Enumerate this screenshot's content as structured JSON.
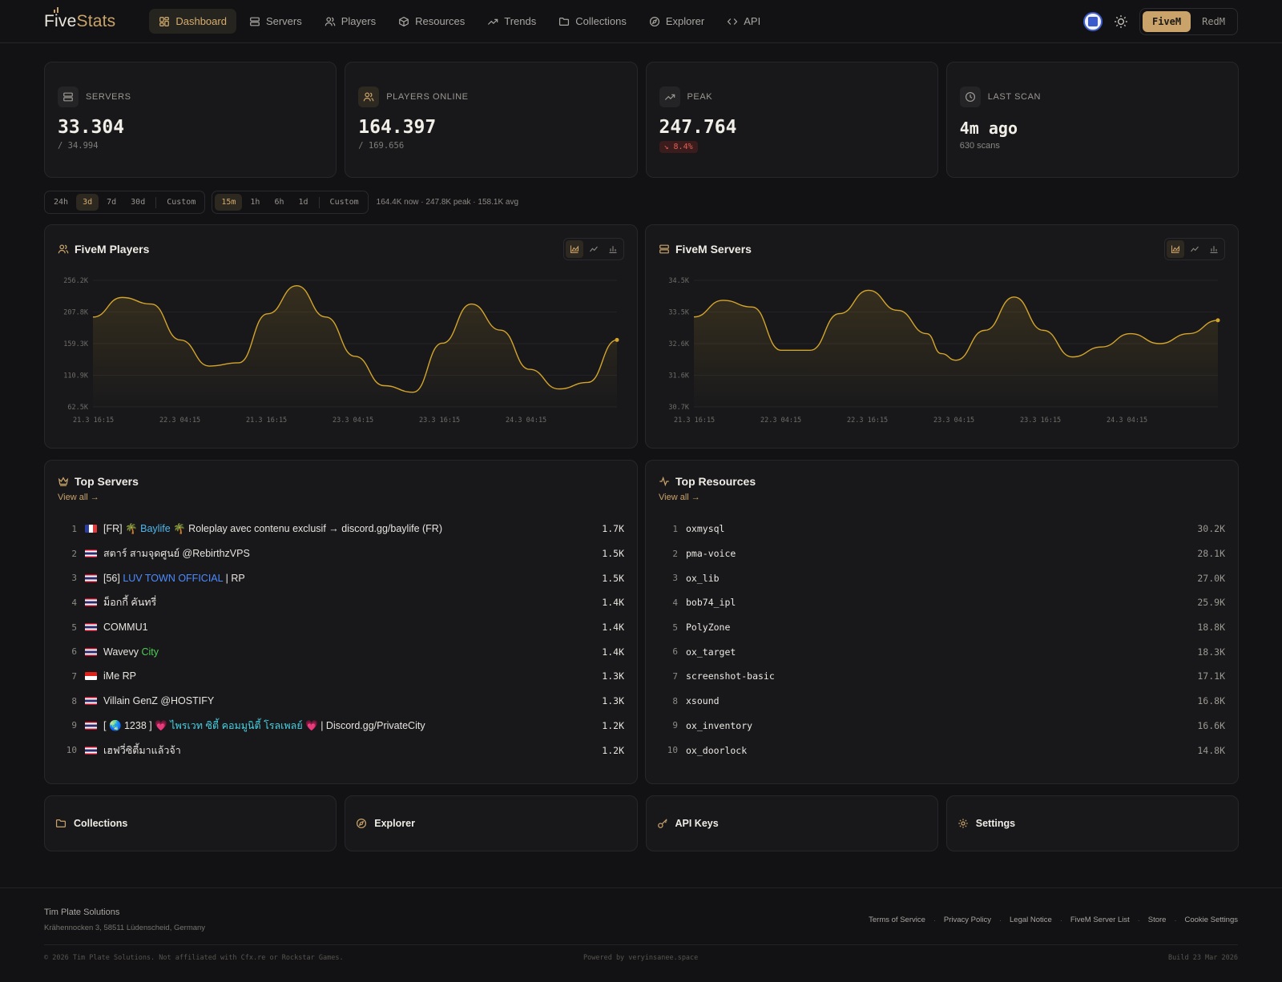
{
  "brand": {
    "five": "Five",
    "stats": "Stats"
  },
  "nav": {
    "items": [
      {
        "label": "Dashboard",
        "icon": "grid-icon"
      },
      {
        "label": "Servers",
        "icon": "server-icon"
      },
      {
        "label": "Players",
        "icon": "users-icon"
      },
      {
        "label": "Resources",
        "icon": "box-icon"
      },
      {
        "label": "Trends",
        "icon": "trending-up-icon"
      },
      {
        "label": "Collections",
        "icon": "folder-icon"
      },
      {
        "label": "Explorer",
        "icon": "compass-icon"
      },
      {
        "label": "API",
        "icon": "code-icon"
      }
    ],
    "active": "Dashboard",
    "game_options": [
      "FiveM",
      "RedM"
    ],
    "game_selected": "FiveM"
  },
  "stats": {
    "servers": {
      "label": "SERVERS",
      "value": "33.304",
      "sub": "/ 34.994"
    },
    "players": {
      "label": "PLAYERS ONLINE",
      "value": "164.397",
      "sub": "/ 169.656"
    },
    "peak": {
      "label": "PEAK",
      "value": "247.764",
      "badge": "↘ 8.4%"
    },
    "scan": {
      "label": "LAST SCAN",
      "value": "4m ago",
      "sub": "630 scans"
    }
  },
  "filters": {
    "range": [
      "24h",
      "3d",
      "7d",
      "30d"
    ],
    "range_custom": "Custom",
    "range_selected": "3d",
    "interval": [
      "15m",
      "1h",
      "6h",
      "1d"
    ],
    "interval_custom": "Custom",
    "interval_selected": "15m",
    "summary": "164.4K now · 247.8K peak · 158.1K avg"
  },
  "chart_data": [
    {
      "type": "area",
      "title": "FiveM Players",
      "color": "#d4a52c",
      "y_ticks": [
        "256.2K",
        "207.8K",
        "159.3K",
        "110.9K",
        "62.5K"
      ],
      "ylim": [
        62500,
        256200
      ],
      "x_ticks": [
        "21.3 16:15",
        "22.3 04:15",
        "21.3 16:15",
        "23.3 04:15",
        "23.3 16:15",
        "24.3 04:15"
      ],
      "x": [
        0,
        4,
        8,
        12,
        16,
        20,
        24,
        28,
        32,
        36,
        40,
        44,
        48,
        52,
        56,
        60,
        64,
        68,
        72
      ],
      "values": [
        200000,
        230000,
        220000,
        165000,
        125000,
        130000,
        205000,
        248000,
        200000,
        140000,
        95000,
        85000,
        160000,
        220000,
        180000,
        120000,
        90000,
        100000,
        165000
      ]
    },
    {
      "type": "area",
      "title": "FiveM Servers",
      "color": "#d4a52c",
      "y_ticks": [
        "34.5K",
        "33.5K",
        "32.6K",
        "31.6K",
        "30.7K"
      ],
      "ylim": [
        30700,
        34500
      ],
      "x_ticks": [
        "21.3 16:15",
        "22.3 04:15",
        "22.3 16:15",
        "23.3 04:15",
        "23.3 16:15",
        "24.3 04:15"
      ],
      "x": [
        0,
        4,
        8,
        12,
        16,
        20,
        24,
        28,
        32,
        34,
        36,
        40,
        44,
        48,
        52,
        56,
        60,
        64,
        68,
        72
      ],
      "values": [
        33400,
        33900,
        33700,
        32400,
        32400,
        33500,
        34200,
        33600,
        32900,
        32300,
        32100,
        33000,
        34000,
        33000,
        32200,
        32500,
        32900,
        32600,
        32900,
        33300
      ]
    }
  ],
  "charts": {
    "players_title": "FiveM Players",
    "servers_title": "FiveM Servers"
  },
  "top_servers": {
    "title": "Top Servers",
    "view_all": "View all →",
    "rows": [
      {
        "rank": "1",
        "flag": "fr",
        "value": "1.7K"
      },
      {
        "rank": "2",
        "flag": "th",
        "name": "สตาร์ สามจุดศูนย์ @RebirthzVPS",
        "value": "1.5K"
      },
      {
        "rank": "3",
        "flag": "th",
        "value": "1.5K"
      },
      {
        "rank": "4",
        "flag": "th",
        "name": "ม็อกกี้ คันทรี่",
        "value": "1.4K"
      },
      {
        "rank": "5",
        "flag": "th",
        "name": "COMMU1",
        "value": "1.4K"
      },
      {
        "rank": "6",
        "flag": "th",
        "value": "1.4K"
      },
      {
        "rank": "7",
        "flag": "id",
        "name": "iMe RP",
        "value": "1.3K"
      },
      {
        "rank": "8",
        "flag": "th",
        "name": "Villain GenZ @HOSTIFY",
        "value": "1.3K"
      },
      {
        "rank": "9",
        "flag": "th",
        "value": "1.2K"
      },
      {
        "rank": "10",
        "flag": "th",
        "name": "เฮฟวี่ซิตี้มาแล้วจ้า",
        "value": "1.2K"
      }
    ],
    "row1_parts": {
      "a": "[FR] 🌴 ",
      "b": "Baylife",
      "c": " 🌴 Roleplay avec contenu exclusif → discord.gg/baylife (FR)"
    },
    "row3_parts": {
      "a": "[56] ",
      "b": "LUV TOWN OFFICIAL",
      "c": " | RP"
    },
    "row6_parts": {
      "a": "Wavevy ",
      "b": "City"
    },
    "row9_parts": {
      "a": "[ 🌏 1238 ] ",
      "b": "💗",
      "c": " ไพรเวท ซิตี้ คอมมูนิตี้ โรลเพลย์ ",
      "d": "💗",
      "e": " | Discord.gg/PrivateCity"
    }
  },
  "top_resources": {
    "title": "Top Resources",
    "view_all": "View all →",
    "rows": [
      {
        "rank": "1",
        "name": "oxmysql",
        "value": "30.2K"
      },
      {
        "rank": "2",
        "name": "pma-voice",
        "value": "28.1K"
      },
      {
        "rank": "3",
        "name": "ox_lib",
        "value": "27.0K"
      },
      {
        "rank": "4",
        "name": "bob74_ipl",
        "value": "25.9K"
      },
      {
        "rank": "5",
        "name": "PolyZone",
        "value": "18.8K"
      },
      {
        "rank": "6",
        "name": "ox_target",
        "value": "18.3K"
      },
      {
        "rank": "7",
        "name": "screenshot-basic",
        "value": "17.1K"
      },
      {
        "rank": "8",
        "name": "xsound",
        "value": "16.8K"
      },
      {
        "rank": "9",
        "name": "ox_inventory",
        "value": "16.6K"
      },
      {
        "rank": "10",
        "name": "ox_doorlock",
        "value": "14.8K"
      }
    ]
  },
  "quick_links": [
    {
      "label": "Collections",
      "icon": "folder-icon"
    },
    {
      "label": "Explorer",
      "icon": "compass-icon"
    },
    {
      "label": "API Keys",
      "icon": "key-icon"
    },
    {
      "label": "Settings",
      "icon": "gear-icon"
    }
  ],
  "footer": {
    "company": "Tim Plate Solutions",
    "address": "Krähennocken 3, 58511 Lüdenscheid, Germany",
    "links": [
      "Terms of Service",
      "Privacy Policy",
      "Legal Notice",
      "FiveM Server List",
      "Store",
      "Cookie Settings"
    ],
    "copyright": "© 2026 Tim Plate Solutions. Not affiliated with Cfx.re or Rockstar Games.",
    "powered": "Powered by veryinsanee.space",
    "build": "Build 23 Mar 2026"
  }
}
